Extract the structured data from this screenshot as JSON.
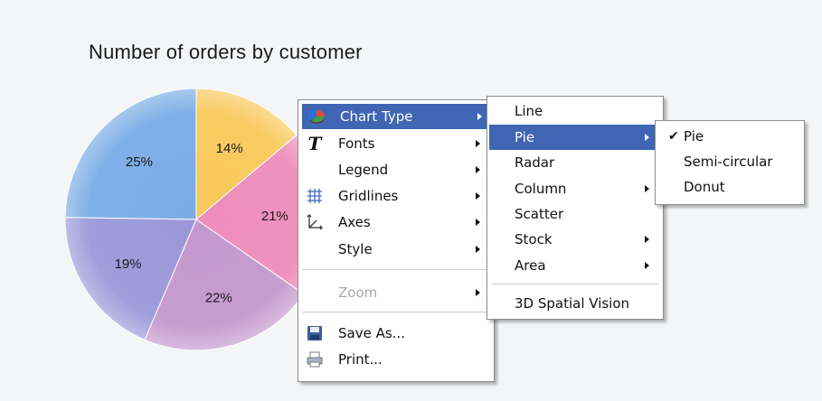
{
  "chart": {
    "title": "Number of orders by customer",
    "colors": {
      "blue": "#7aace6",
      "yellow": "#f8c95a",
      "pink": "#ee8dbb",
      "mauve": "#c498cd",
      "lavender": "#9b98d9"
    }
  },
  "chart_data": {
    "type": "pie",
    "title": "Number of orders by customer",
    "slices": [
      {
        "label": "25%",
        "value": 25,
        "color": "#7aace6"
      },
      {
        "label": "14%",
        "value": 14,
        "color": "#f8c95a"
      },
      {
        "label": "21%",
        "value": 21,
        "color": "#ee8dbb"
      },
      {
        "label": "22%",
        "value": 22,
        "color": "#c498cd"
      },
      {
        "label": "19%",
        "value": 19,
        "color": "#9b98d9"
      }
    ]
  },
  "context_menu": {
    "items": [
      {
        "label": "Chart Type",
        "icon": "pie-chart-icon",
        "submenu": true,
        "selected": true
      },
      {
        "label": "Fonts",
        "icon": "font-t-icon",
        "submenu": true
      },
      {
        "label": "Legend",
        "submenu": true
      },
      {
        "label": "Gridlines",
        "icon": "gridlines-icon",
        "submenu": true
      },
      {
        "label": "Axes",
        "icon": "axes-icon",
        "submenu": true
      },
      {
        "label": "Style",
        "submenu": true
      },
      {
        "label": "Zoom",
        "submenu": true,
        "disabled": true
      },
      {
        "label": "Save As...",
        "icon": "floppy-disk-icon"
      },
      {
        "label": "Print...",
        "icon": "printer-icon"
      }
    ]
  },
  "chart_type_menu": {
    "items": [
      {
        "label": "Line"
      },
      {
        "label": "Pie",
        "submenu": true,
        "selected": true
      },
      {
        "label": "Radar"
      },
      {
        "label": "Column",
        "submenu": true
      },
      {
        "label": "Scatter"
      },
      {
        "label": "Stock",
        "submenu": true
      },
      {
        "label": "Area",
        "submenu": true
      },
      {
        "label": "3D Spatial Vision"
      }
    ]
  },
  "pie_menu": {
    "items": [
      {
        "label": "Pie",
        "checked": true,
        "check": "✔"
      },
      {
        "label": "Semi-circular"
      },
      {
        "label": "Donut"
      }
    ]
  }
}
